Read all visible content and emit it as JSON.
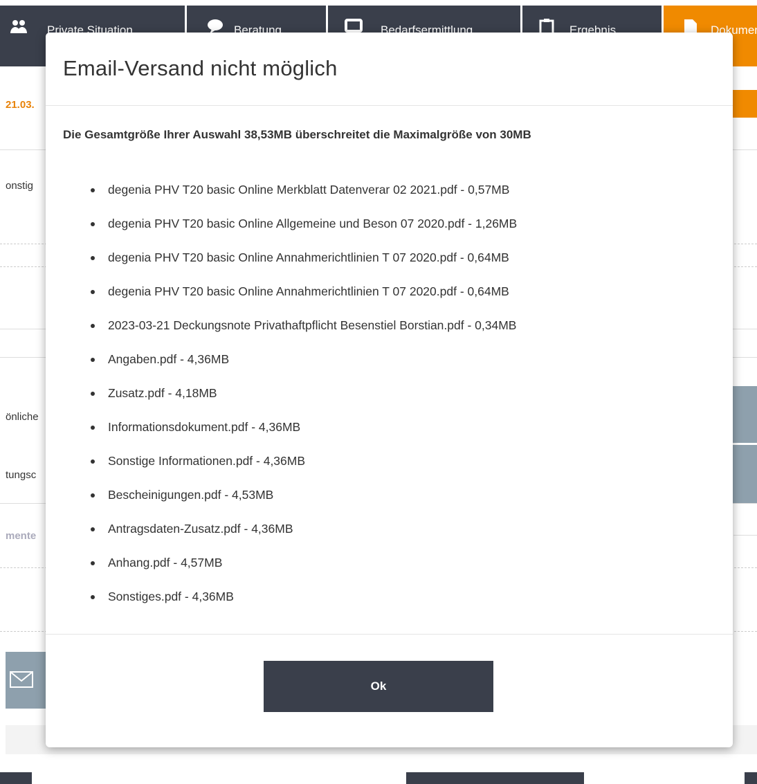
{
  "nav": {
    "tabs": [
      {
        "label": "Private Situation",
        "icon": "users-icon"
      },
      {
        "label": "Beratung",
        "icon": "speech-bubble-icon"
      },
      {
        "label": "Bedarfsermittlung",
        "icon": "monitor-icon"
      },
      {
        "label": "Ergebnis",
        "icon": "clipboard-icon"
      },
      {
        "label": "Dokumente",
        "icon": "document-icon"
      }
    ]
  },
  "background": {
    "date_label": "21.03.",
    "row1": "onstig",
    "row2": "önliche",
    "row3": "tungsc",
    "row4": "mente"
  },
  "modal": {
    "title": "Email-Versand nicht möglich",
    "message": "Die Gesamtgröße Ihrer Auswahl 38,53MB überschreitet die Maximalgröße von 30MB",
    "files": [
      "degenia PHV T20 basic Online Merkblatt Datenverar 02 2021.pdf - 0,57MB",
      "degenia PHV T20 basic Online Allgemeine und Beson 07 2020.pdf - 1,26MB",
      "degenia PHV T20 basic Online Annahmerichtlinien T 07 2020.pdf - 0,64MB",
      "degenia PHV T20 basic Online Annahmerichtlinien T 07 2020.pdf - 0,64MB",
      "2023-03-21 Deckungsnote Privathaftpflicht Besenstiel Borstian.pdf - 0,34MB",
      "Angaben.pdf - 4,36MB",
      "Zusatz.pdf - 4,18MB",
      "Informationsdokument.pdf - 4,36MB",
      "Sonstige Informationen.pdf - 4,36MB",
      "Bescheinigungen.pdf - 4,53MB",
      "Antragsdaten-Zusatz.pdf - 4,36MB",
      "Anhang.pdf - 4,57MB",
      "Sonstiges.pdf - 4,36MB"
    ],
    "ok_label": "Ok"
  },
  "colors": {
    "nav_dark": "#3a3f4b",
    "accent_orange": "#f08a00",
    "side_blue_grey": "#8ea0ad"
  }
}
